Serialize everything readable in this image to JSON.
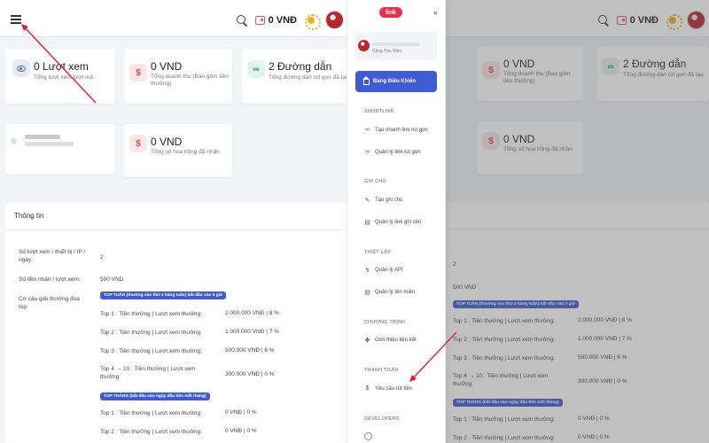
{
  "header": {
    "balance": "0 VNĐ"
  },
  "stats": {
    "views_value": "0 Lượt xem",
    "views_sub": "Tổng lượt xem lượt mã",
    "revenue_value": "0 VND",
    "revenue_sub": "Tổng doanh thu (Bao gồm tiền thưởng)",
    "links_value": "2 Đường dẫn",
    "links_sub": "Tổng đường dẫn rút gọn đã tạo",
    "commission_value": "0 VND",
    "commission_sub": "Tổng số hoa hồng đã nhận"
  },
  "info": {
    "title": "Thông tin",
    "views_per_device_label": "Số lượt xem / thiết bị / IP / ngày:",
    "views_per_device_value": "2",
    "payout_label": "Số tiền nhận / lượt xem:",
    "payout_value": "500 VND",
    "reward_label": "Cơ cấu giải thưởng đua top:",
    "weekly_badge": "TOP TUẦN (thưởng vào thứ 2 hàng tuần) bắt đầu vào 0 giờ",
    "weekly": [
      {
        "label": "Top 1 : Tiền thưởng | Lượt xem thưởng:",
        "value": "2.000.000 VNĐ | 8 %"
      },
      {
        "label": "Top 2 : Tiền thưởng | Lượt xem thưởng:",
        "value": "1.000.000 VNĐ | 7 %"
      },
      {
        "label": "Top 3 : Tiền thưởng | Lượt xem thưởng:",
        "value": "500.000 VNĐ | 6 %"
      },
      {
        "label": "Top 4 → 10 : Tiền thưởng | Lượt xem thưởng:",
        "value": "300.000 VNĐ | 0 %"
      }
    ],
    "monthly_badge": "TOP THÁNG (bắt đầu vào ngày đầu tiên mỗi tháng)",
    "monthly": [
      {
        "label": "Top 1 : Tiền thưởng | Lượt xem thưởng:",
        "value": "0 VNĐ | 0 %"
      },
      {
        "label": "Top 2 : Tiền thưởng | Lượt xem thưởng:",
        "value": "0 VNĐ | 0 %"
      }
    ]
  },
  "sidebar": {
    "logo": "link",
    "collapse_icon": "«",
    "role": "Cộng Tác Viên",
    "dashboard": "Bảng Điều Khiển",
    "sections": {
      "shortlink": "SHORTLINK",
      "note": "GHI CHÚ",
      "settings": "THIẾT LẬP",
      "program": "CHƯƠNG TRÌNH",
      "payment": "THANH TOÁN",
      "developers": "DEVELOPERS"
    },
    "items": {
      "quick_link": "Tạo nhanh link rút gọn",
      "manage_links": "Quản lý link rút gọn",
      "create_note": "Tạo ghi chú",
      "manage_notes": "Quản lý link ghi chú",
      "api": "Quản lý API",
      "domains": "Quản lý tên miền",
      "referral": "Giới thiệu liên kết",
      "withdraw": "Yêu cầu rút tiền"
    }
  },
  "colors": {
    "accent": "#3f5bd3",
    "annotation_arrow": "#e0192d",
    "logo": "#e8314a"
  }
}
